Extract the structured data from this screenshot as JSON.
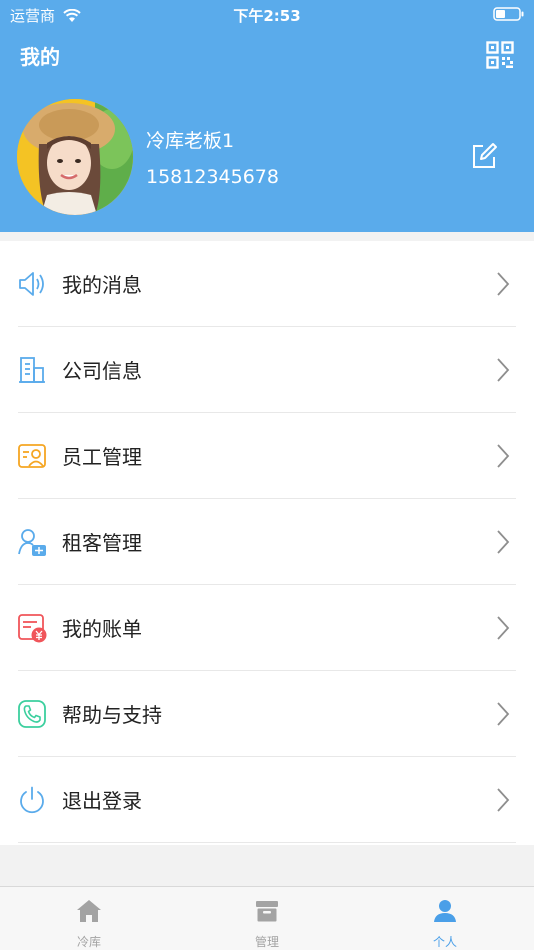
{
  "status_bar": {
    "carrier": "运营商",
    "time": "下午2:53"
  },
  "header": {
    "title": "我的"
  },
  "profile": {
    "name": "冷库老板1",
    "phone": "15812345678"
  },
  "menu": [
    {
      "label": "我的消息",
      "icon": "speaker-icon",
      "color": "#5aabeb"
    },
    {
      "label": "公司信息",
      "icon": "building-icon",
      "color": "#5aabeb"
    },
    {
      "label": "员工管理",
      "icon": "staff-card-icon",
      "color": "#f5a623"
    },
    {
      "label": "租客管理",
      "icon": "tenant-icon",
      "color": "#5aabeb"
    },
    {
      "label": "我的账单",
      "icon": "bill-icon",
      "color": "#f0555a"
    },
    {
      "label": "帮助与支持",
      "icon": "phone-support-icon",
      "color": "#3ccf9e"
    },
    {
      "label": "退出登录",
      "icon": "power-icon",
      "color": "#5aabeb"
    }
  ],
  "tabbar": {
    "active": "个人",
    "tabs": [
      {
        "label": "冷库",
        "icon": "home-icon"
      },
      {
        "label": "管理",
        "icon": "archive-box-icon"
      },
      {
        "label": "个人",
        "icon": "person-icon"
      }
    ]
  },
  "colors": {
    "primary": "#5aabeb",
    "active_tab": "#4a9fe8",
    "inactive_tab": "#a3a3a3"
  }
}
